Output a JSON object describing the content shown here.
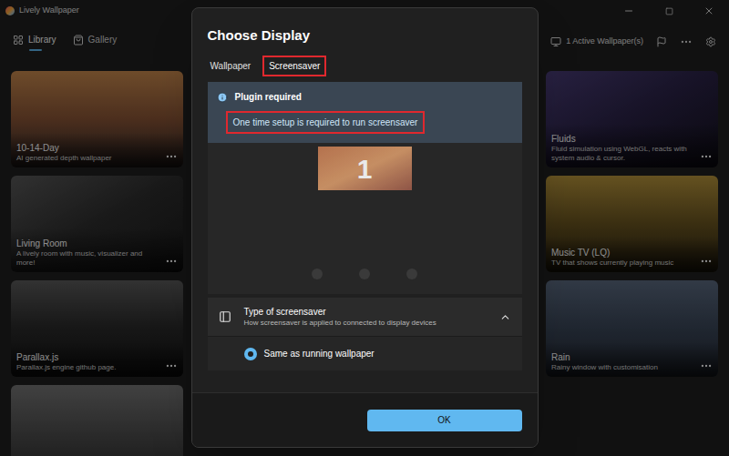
{
  "window": {
    "title": "Lively Wallpaper"
  },
  "nav": [
    {
      "label": "Library",
      "selected": true
    },
    {
      "label": "Gallery",
      "selected": false
    }
  ],
  "toolbar": {
    "active_wallpapers": "1 Active Wallpaper(s)"
  },
  "library": {
    "left": [
      {
        "title": "10-14-Day",
        "description": "AI generated depth wallpaper"
      },
      {
        "title": "Living Room",
        "description": "A lively room with music, visualizer and more!"
      },
      {
        "title": "Parallax.js",
        "description": "Parallax.js engine github page."
      }
    ],
    "right": [
      {
        "title": "Fluids",
        "description": "Fluid simulation using WebGL, reacts with system audio & cursor."
      },
      {
        "title": "Music TV (LQ)",
        "description": "TV that shows currently playing music"
      },
      {
        "title": "Rain",
        "description": "Rainy window with customisation"
      }
    ]
  },
  "dialog": {
    "title": "Choose Display",
    "tabs": [
      {
        "label": "Wallpaper",
        "selected": false,
        "highlighted": false
      },
      {
        "label": "Screensaver",
        "selected": true,
        "highlighted": true
      }
    ],
    "notice": {
      "title": "Plugin required",
      "message": "One time setup is required to run screensaver",
      "highlighted": true
    },
    "displays": [
      {
        "label": "1",
        "selected": true
      }
    ],
    "preview_pages": [
      {
        "selected": false
      },
      {
        "selected": false
      },
      {
        "selected": false
      }
    ],
    "screensaver_type": {
      "title": "Type of screensaver",
      "subtitle": "How screensaver is applied to connected to display devices",
      "expanded": true,
      "options": [
        {
          "label": "Same as running wallpaper",
          "selected": true
        }
      ]
    },
    "buttons": [
      "OK"
    ]
  }
}
